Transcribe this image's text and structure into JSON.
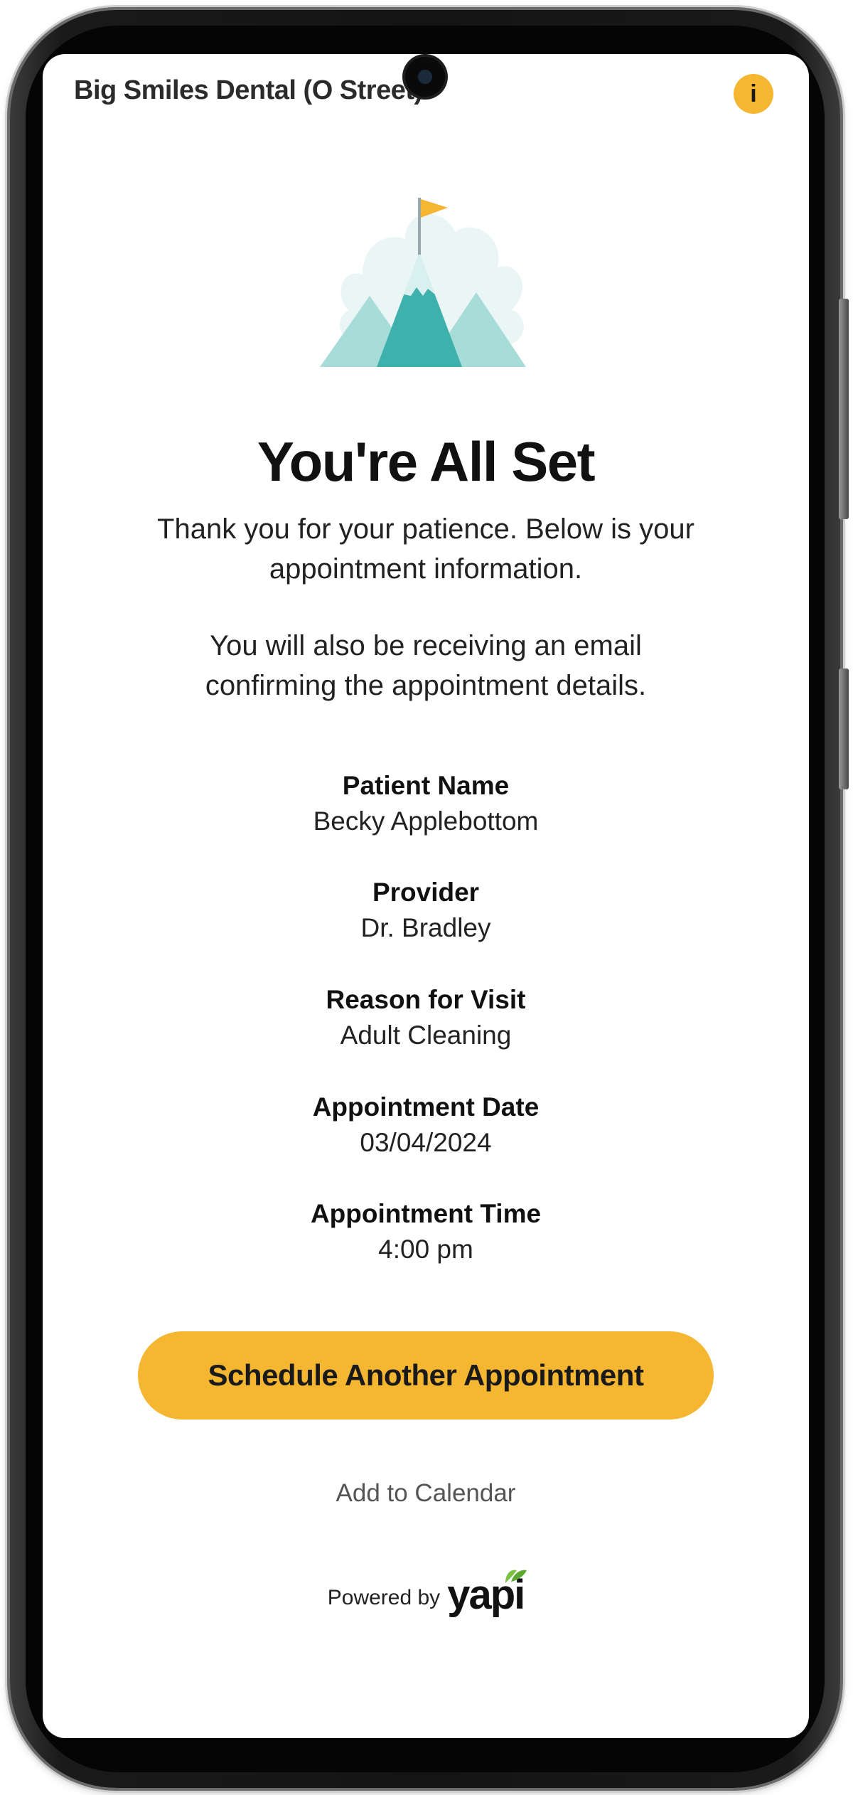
{
  "header": {
    "clinic_name": "Big Smiles Dental (O Street)",
    "info_icon": "info-icon",
    "info_glyph": "i"
  },
  "confirmation": {
    "title": "You're All Set",
    "message_line1": "Thank you for your patience. Below is your appointment information.",
    "message_line2": "You will also be receiving an email confirming the appointment details."
  },
  "details": [
    {
      "label": "Patient Name",
      "value": "Becky Applebottom"
    },
    {
      "label": "Provider",
      "value": "Dr. Bradley"
    },
    {
      "label": "Reason for Visit",
      "value": "Adult Cleaning"
    },
    {
      "label": "Appointment Date",
      "value": "03/04/2024"
    },
    {
      "label": "Appointment Time",
      "value": "4:00 pm"
    }
  ],
  "actions": {
    "schedule_label": "Schedule Another Appointment",
    "add_calendar_label": "Add to Calendar"
  },
  "footer": {
    "powered_by": "Powered by",
    "brand": "yapi"
  },
  "colors": {
    "accent": "#f5b731",
    "mountain_teal": "#3fb1ad",
    "mountain_light": "#a8dcd9",
    "leaf_green": "#7cc242"
  }
}
